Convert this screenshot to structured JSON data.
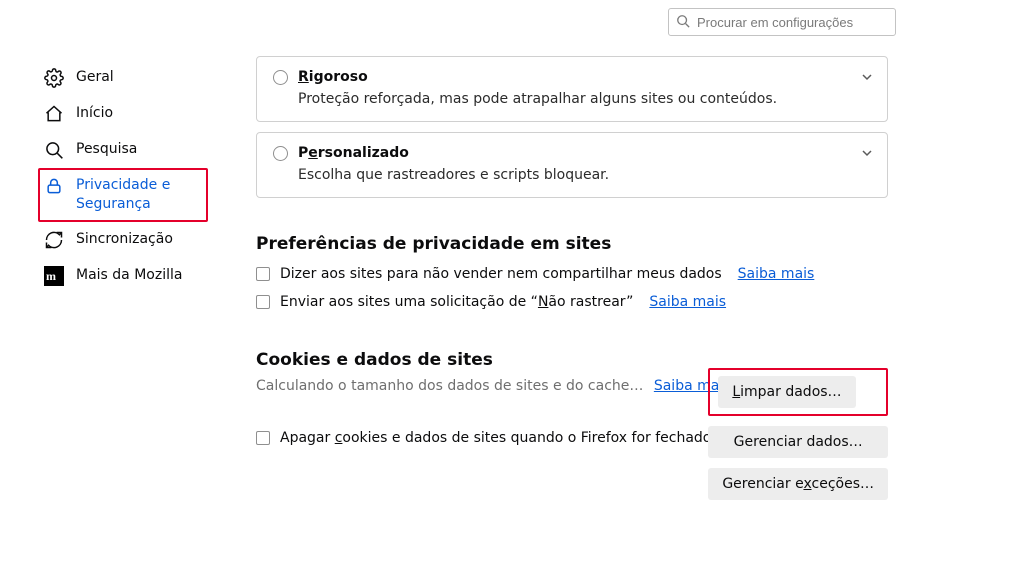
{
  "search": {
    "placeholder": "Procurar em configurações"
  },
  "sidebar": {
    "items": [
      {
        "label": "Geral"
      },
      {
        "label": "Início"
      },
      {
        "label": "Pesquisa"
      },
      {
        "label": "Privacidade e Segurança"
      },
      {
        "label": "Sincronização"
      },
      {
        "label": "Mais da Mozilla"
      }
    ]
  },
  "tracking": {
    "rigoroso": {
      "title_pre": "R",
      "title_rest": "igoroso",
      "desc": "Proteção reforçada, mas pode atrapalhar alguns sites ou conteúdos."
    },
    "personalizado": {
      "title_pre": "P",
      "title_u": "e",
      "title_rest": "rsonalizado",
      "desc": "Escolha que rastreadores e scripts bloquear."
    }
  },
  "privacy_prefs": {
    "heading": "Preferências de privacidade em sites",
    "row1": {
      "text": "Dizer aos sites para não vender nem compartilhar meus dados",
      "link": "Saiba mais"
    },
    "row2": {
      "text_pre": "Enviar aos sites uma solicitação de “",
      "u": "N",
      "text_post": "ão rastrear”",
      "link": "Saiba mais"
    }
  },
  "cookies": {
    "heading": "Cookies e dados de sites",
    "desc": "Calculando o tamanho dos dados de sites e do cache…",
    "desc_link": "Saiba mais",
    "clear_btn_u": "L",
    "clear_btn_rest": "impar dados…",
    "manage_btn": "Gerenciar dados…",
    "exc_btn_pre": "Gerenciar e",
    "exc_btn_u": "x",
    "exc_btn_rest": "ceções…",
    "delete_on_close_pre": "Apagar ",
    "delete_on_close_u": "c",
    "delete_on_close_rest": "ookies e dados de sites quando o Firefox for fechado"
  }
}
